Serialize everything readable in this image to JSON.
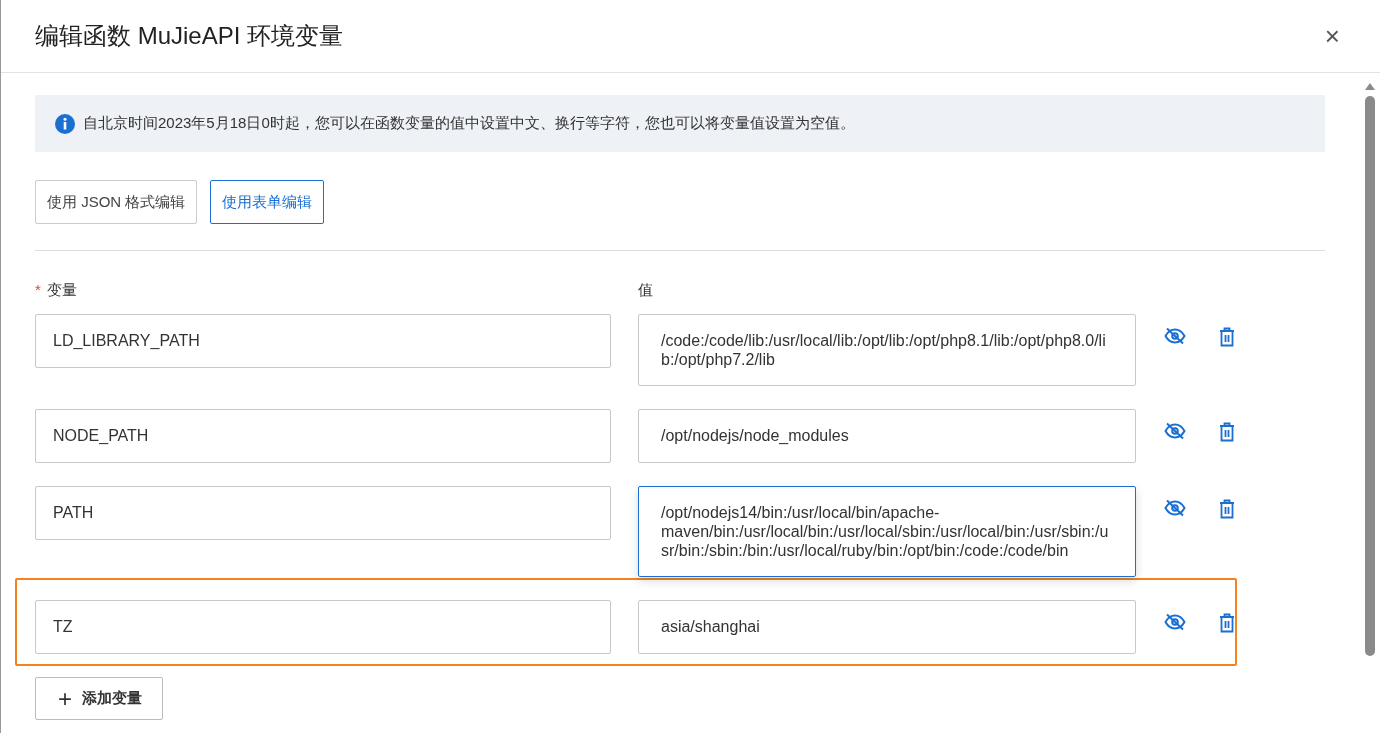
{
  "dialog": {
    "title": "编辑函数 MuJieAPI 环境变量",
    "close": "×"
  },
  "notice": "自北京时间2023年5月18日0时起，您可以在函数变量的值中设置中文、换行等字符，您也可以将变量值设置为空值。",
  "modes": [
    {
      "label": "使用 JSON 格式编辑",
      "selected": false
    },
    {
      "label": "使用表单编辑",
      "selected": true
    }
  ],
  "columns": {
    "name": "变量",
    "name_required_mark": "*",
    "value": "值"
  },
  "variables": [
    {
      "name": "LD_LIBRARY_PATH",
      "value": "/code:/code/lib:/usr/local/lib:/opt/lib:/opt/php8.1/lib:/opt/php8.0/lib:/opt/php7.2/lib",
      "focused": false,
      "highlighted": false
    },
    {
      "name": "NODE_PATH",
      "value": "/opt/nodejs/node_modules",
      "focused": false,
      "highlighted": false
    },
    {
      "name": "PATH",
      "value": "/opt/nodejs14/bin:/usr/local/bin/apache-maven/bin:/usr/local/bin:/usr/local/sbin:/usr/local/bin:/usr/sbin:/usr/bin:/sbin:/bin:/usr/local/ruby/bin:/opt/bin:/code:/code/bin",
      "focused": true,
      "highlighted": false
    },
    {
      "name": "TZ",
      "value": "asia/shanghai",
      "focused": false,
      "highlighted": true
    }
  ],
  "add_button": {
    "icon": "+",
    "label": "添加变量"
  }
}
